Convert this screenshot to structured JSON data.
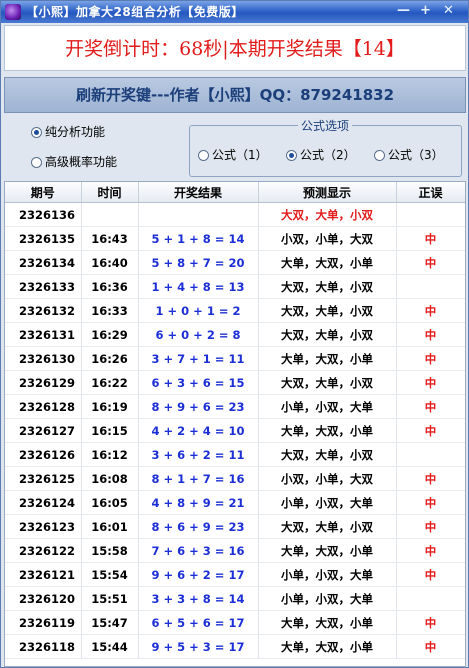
{
  "window": {
    "title": "【小熙】加拿大28组合分析【免费版】",
    "buttons": {
      "minimize": "—",
      "maximize": "+",
      "close": "✕"
    }
  },
  "banner": {
    "text": "开奖倒计时：68秒|本期开奖结果【14】"
  },
  "refresh": {
    "text": "刷新开奖键---作者【小熙】QQ：879241832"
  },
  "modes": {
    "pure": "纯分析功能",
    "advanced": "高级概率功能",
    "selected": "pure"
  },
  "formula": {
    "legend": "公式选项",
    "options": [
      "公式（1）",
      "公式（2）",
      "公式（3）"
    ],
    "selected": 1
  },
  "table": {
    "headers": [
      "期号",
      "时间",
      "开奖结果",
      "预测显示",
      "正误"
    ],
    "rows": [
      {
        "issue": "2326136",
        "time": "",
        "result": "",
        "prediction": "大双，大单，小双",
        "hit": "",
        "pending": true
      },
      {
        "issue": "2326135",
        "time": "16:43",
        "result": "5 + 1 + 8 = 14",
        "prediction": "小双，小单，大双",
        "hit": "中"
      },
      {
        "issue": "2326134",
        "time": "16:40",
        "result": "5 + 8 + 7 = 20",
        "prediction": "大单，大双，小单",
        "hit": "中"
      },
      {
        "issue": "2326133",
        "time": "16:36",
        "result": "1 + 4 + 8 = 13",
        "prediction": "大双，大单，小双",
        "hit": ""
      },
      {
        "issue": "2326132",
        "time": "16:33",
        "result": "1 + 0 + 1 = 2",
        "prediction": "大双，大单，小双",
        "hit": "中"
      },
      {
        "issue": "2326131",
        "time": "16:29",
        "result": "6 + 0 + 2 = 8",
        "prediction": "大双，大单，小双",
        "hit": "中"
      },
      {
        "issue": "2326130",
        "time": "16:26",
        "result": "3 + 7 + 1 = 11",
        "prediction": "大单，大双，小单",
        "hit": "中"
      },
      {
        "issue": "2326129",
        "time": "16:22",
        "result": "6 + 3 + 6 = 15",
        "prediction": "大双，大单，小双",
        "hit": "中"
      },
      {
        "issue": "2326128",
        "time": "16:19",
        "result": "8 + 9 + 6 = 23",
        "prediction": "小单，小双，大单",
        "hit": "中"
      },
      {
        "issue": "2326127",
        "time": "16:15",
        "result": "4 + 2 + 4 = 10",
        "prediction": "大单，大双，小单",
        "hit": "中"
      },
      {
        "issue": "2326126",
        "time": "16:12",
        "result": "3 + 6 + 2 = 11",
        "prediction": "大双，大单，小双",
        "hit": ""
      },
      {
        "issue": "2326125",
        "time": "16:08",
        "result": "8 + 1 + 7 = 16",
        "prediction": "小双，小单，大双",
        "hit": "中"
      },
      {
        "issue": "2326124",
        "time": "16:05",
        "result": "4 + 8 + 9 = 21",
        "prediction": "小单，小双，大单",
        "hit": "中"
      },
      {
        "issue": "2326123",
        "time": "16:01",
        "result": "8 + 6 + 9 = 23",
        "prediction": "大双，大单，小双",
        "hit": "中"
      },
      {
        "issue": "2326122",
        "time": "15:58",
        "result": "7 + 6 + 3 = 16",
        "prediction": "大单，大双，小单",
        "hit": "中"
      },
      {
        "issue": "2326121",
        "time": "15:54",
        "result": "9 + 6 + 2 = 17",
        "prediction": "小单，小双，大单",
        "hit": "中"
      },
      {
        "issue": "2326120",
        "time": "15:51",
        "result": "3 + 3 + 8 = 14",
        "prediction": "小单，小双，大单",
        "hit": ""
      },
      {
        "issue": "2326119",
        "time": "15:47",
        "result": "6 + 5 + 6 = 17",
        "prediction": "大单，大双，小单",
        "hit": "中"
      },
      {
        "issue": "2326118",
        "time": "15:44",
        "result": "9 + 5 + 3 = 17",
        "prediction": "大单，大双，小单",
        "hit": "中"
      }
    ]
  },
  "colors": {
    "title_bar": "#2f63c8",
    "banner_text": "#e21b1b",
    "result_text": "#1c2fd6",
    "hit_text": "#e21b1b"
  },
  "icons": {
    "app": "app-icon"
  }
}
